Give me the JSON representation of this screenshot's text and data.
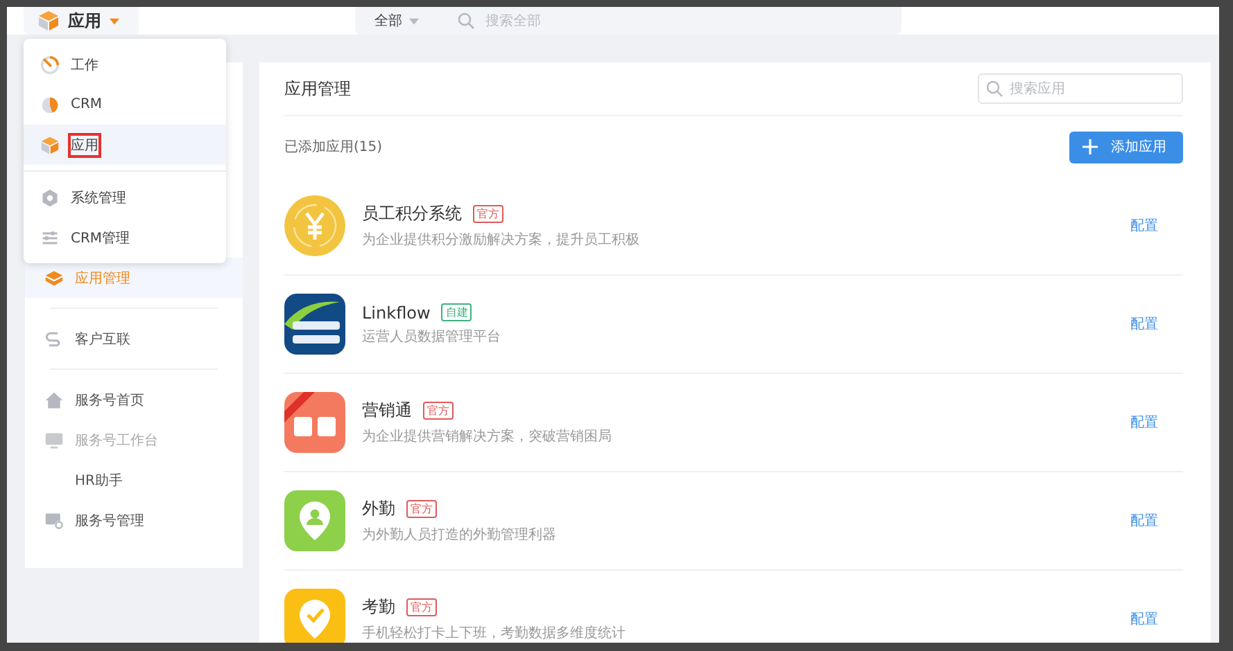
{
  "app_switcher": {
    "label": "应用"
  },
  "global_search": {
    "scope": "全部",
    "placeholder": "搜索全部"
  },
  "app_menu": {
    "items": [
      {
        "label": "工作",
        "selected": false
      },
      {
        "label": "CRM",
        "selected": false
      },
      {
        "label": "应用",
        "selected": true
      },
      {
        "label": "系统管理",
        "selected": false
      },
      {
        "label": "CRM管理",
        "selected": false
      }
    ]
  },
  "sidebar": {
    "items": [
      {
        "label": "应用管理",
        "selected": true,
        "disabled": false
      },
      {
        "label": "客户互联",
        "selected": false,
        "disabled": false
      },
      {
        "label": "服务号首页",
        "selected": false,
        "disabled": false
      },
      {
        "label": "服务号工作台",
        "selected": false,
        "disabled": true
      },
      {
        "label": "HR助手",
        "selected": false,
        "disabled": false
      },
      {
        "label": "服务号管理",
        "selected": false,
        "disabled": false
      }
    ]
  },
  "main": {
    "title": "应用管理",
    "search": {
      "placeholder": "搜索应用"
    },
    "count_label": "已添加应用(15)",
    "add_button": "添加应用",
    "apps": [
      {
        "name": "员工积分系统",
        "tag": "官方",
        "color": "#e05a5a",
        "description": "为企业提供积分激励解决方案，提升员工积极",
        "action": "配置"
      },
      {
        "name": "Linkflow",
        "tag": "自建",
        "color": "#3fb27f",
        "description": "运营人员数据管理平台",
        "action": "配置"
      },
      {
        "name": "营销通",
        "tag": "官方",
        "color": "#e05a5a",
        "description": "为企业提供营销解决方案，突破营销困局",
        "action": "配置"
      },
      {
        "name": "外勤",
        "tag": "官方",
        "color": "#e05a5a",
        "description": "为外勤人员打造的外勤管理利器",
        "action": "配置"
      },
      {
        "name": "考勤",
        "tag": "官方",
        "color": "#e05a5a",
        "description": "手机轻松打卡上下班，考勤数据多维度统计",
        "action": "配置"
      }
    ]
  }
}
